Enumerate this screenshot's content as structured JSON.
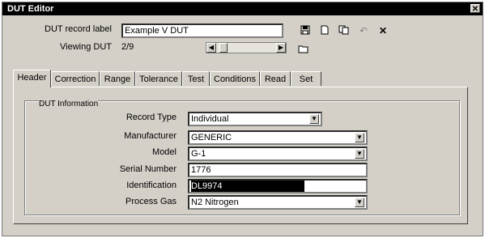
{
  "window": {
    "title": "DUT Editor"
  },
  "header": {
    "record_label_label": "DUT record label",
    "record_label_value": "Example V DUT",
    "viewing_label": "Viewing DUT",
    "viewing_value": "2/9"
  },
  "tabs": [
    {
      "label": "Header",
      "active": true
    },
    {
      "label": "Correction"
    },
    {
      "label": "Range"
    },
    {
      "label": "Tolerance"
    },
    {
      "label": "Test"
    },
    {
      "label": "Conditions"
    },
    {
      "label": "Read"
    },
    {
      "label": "Set"
    }
  ],
  "dut_info": {
    "group_label": "DUT Information",
    "record_type_label": "Record Type",
    "record_type_value": "Individual",
    "manufacturer_label": "Manufacturer",
    "manufacturer_value": "GENERIC",
    "model_label": "Model",
    "model_value": "G-1",
    "serial_label": "Serial Number",
    "serial_value": "1776",
    "identification_label": "Identification",
    "identification_value": "DL9974",
    "process_gas_label": "Process Gas",
    "process_gas_value": "N2 Nitrogen"
  }
}
